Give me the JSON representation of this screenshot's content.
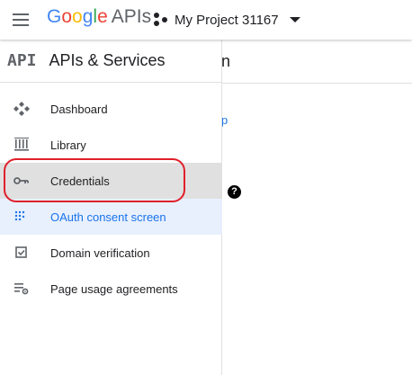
{
  "header": {
    "brand": {
      "google": [
        "G",
        "o",
        "o",
        "g",
        "l",
        "e"
      ],
      "apis": "APIs"
    },
    "project_name": "My Project 31167",
    "icons": {
      "menu": "hamburger-menu-icon",
      "project": "project-nodes-icon",
      "caret": "caret-down-icon"
    }
  },
  "sidebar": {
    "api_logo": "API",
    "title": "APIs & Services",
    "items": [
      {
        "label": "Dashboard",
        "icon": "dashboard-icon",
        "state": "normal"
      },
      {
        "label": "Library",
        "icon": "library-icon",
        "state": "normal"
      },
      {
        "label": "Credentials",
        "icon": "key-icon",
        "state": "selected",
        "highlighted": true
      },
      {
        "label": "OAuth consent screen",
        "icon": "oauth-consent-icon",
        "state": "active"
      },
      {
        "label": "Domain verification",
        "icon": "checkbox-icon",
        "state": "normal"
      },
      {
        "label": "Page usage agreements",
        "icon": "settings-list-icon",
        "state": "normal"
      }
    ]
  },
  "main": {
    "title_fragment": "n",
    "link_fragment": "p",
    "help_glyph": "?"
  },
  "colors": {
    "brand_blue": "#4285f4",
    "brand_red": "#ea4335",
    "brand_yellow": "#fbbc05",
    "brand_green": "#34a853",
    "accent": "#1a73e8",
    "selected_bg": "#e0e0e0",
    "active_bg": "#e8f0fe",
    "annotation_ring": "#e0202a"
  }
}
